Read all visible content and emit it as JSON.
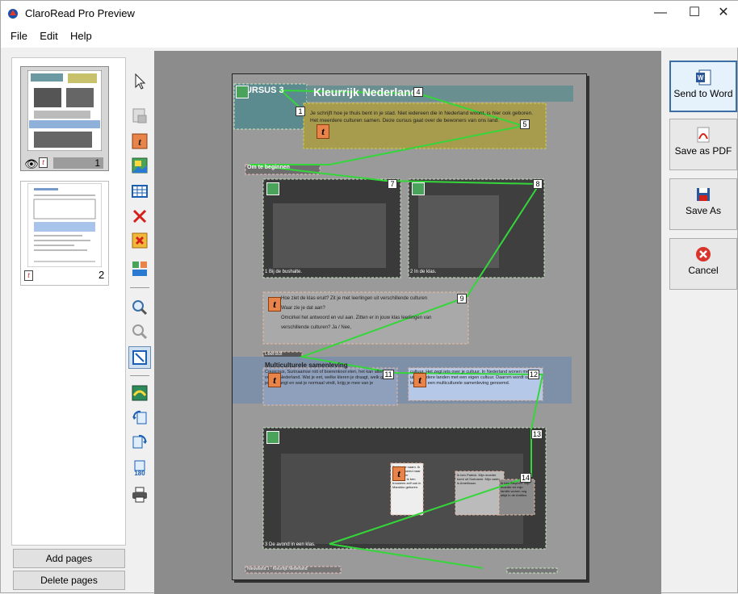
{
  "window": {
    "title": "ClaroRead Pro Preview",
    "min": "—",
    "max": "☐",
    "close": "✕"
  },
  "menu": [
    {
      "label": "File"
    },
    {
      "label": "Edit"
    },
    {
      "label": "Help"
    }
  ],
  "thumbnails": [
    {
      "number": "1"
    },
    {
      "number": "2"
    }
  ],
  "left_buttons": {
    "add": "Add pages",
    "delete": "Delete pages"
  },
  "actions": {
    "word": "Send to Word",
    "pdf": "Save as PDF",
    "saveas": "Save As",
    "cancel": "Cancel"
  },
  "document": {
    "header_left": "CURSUS 3",
    "header_title": "Kleurrijk Nederland",
    "intro": "Je schrijft hoe je thuis bent in je stad. Niet iedereen die in Nederland woont, is hier ook geboren. Het meerdere culturen samen. Deze cursus gaat over de bewoners van ons land.",
    "section1": "Om te beginnen",
    "cap1": "1  Bij de bushalte.",
    "cap2": "2  In de klas.",
    "q_lines": [
      "Hoe ziet de klas eruit? Zit je met leerlingen uit verschillende culturen",
      "Waar zie je dat aan?",
      "Omcirkel het antwoord en vul aan. Zitten er in jouw klas leerlingen van",
      "verschillende culturen? Ja / Nee,",
      "Hoe zie of merk je dat ze uit een andere cultuur komen?"
    ],
    "leerstof": "Leerstof",
    "multi_title": "Multiculturele samenleving",
    "multi_left": "Couscous, Surinaamse roti of boerenkool eten, het kan allemaal voor in Nederland. Wat je eet, welke kleren je draagt, welk geloof je aanhangt en wat je normaal vindt, krijg je mee van je",
    "multi_right": "cultuur. Het zegt iets over je cultuur. In Nederland wonen mensen uit meerdere landen met een eigen cultuur. Daarom wordt ons land wel een multiculturele samenleving genoemd.",
    "cap3": "3  De avond in een klas.",
    "speech1": "Sold is de naam. Ik ben vernoemd naar mijn opa in Marokko. Ik ben trouwens zelf ook in Marokko geboren.",
    "speech2": "Ik ben Patrick. Mijn moeder komt uit Suriname. Mijn vader is Amerikaan.",
    "speech3": "Ik ben Stephen. Mijn moeder en mijn familie wonen nog altijd in de Antillen.",
    "footer_left": "Nieuwland 1 · Kleurrijk Nederland",
    "footer_right": "",
    "markers": [
      "1",
      "4",
      "5",
      "7",
      "8",
      "9",
      "11",
      "12",
      "13",
      "14"
    ]
  },
  "icons": {
    "t_label": "t",
    "rotate_label": "180"
  }
}
